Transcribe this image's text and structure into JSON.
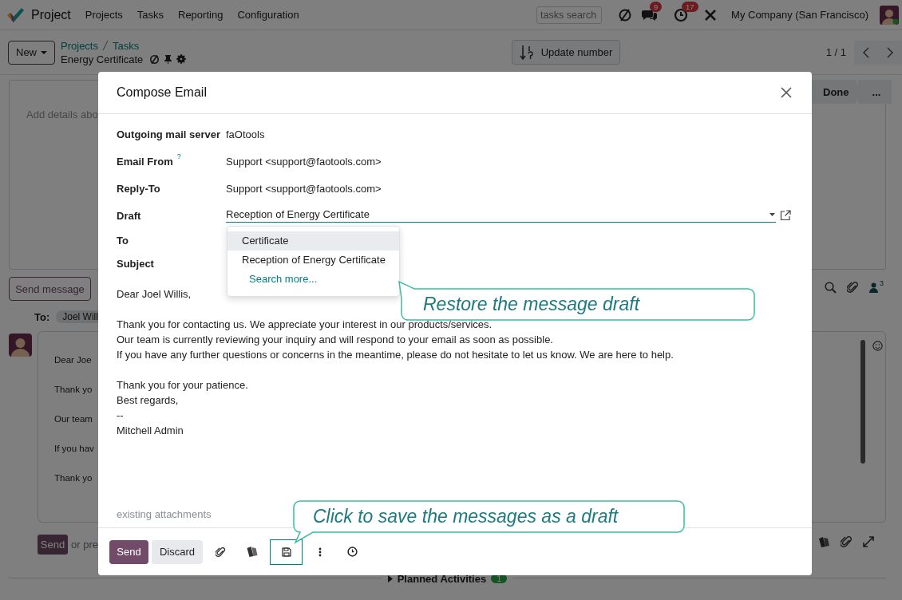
{
  "navbar": {
    "app_name": "Project",
    "menu": [
      "Projects",
      "Tasks",
      "Reporting",
      "Configuration"
    ],
    "search": {
      "placeholder": "tasks search"
    },
    "message_count": "9",
    "activity_count": "17",
    "company": "My Company (San Francisco)"
  },
  "control_panel": {
    "new_button": "New",
    "breadcrumbs": [
      "Projects",
      "Tasks"
    ],
    "record_title": "Energy Certificate",
    "action_button": "Update number",
    "pager": "1 / 1"
  },
  "form": {
    "stages": [
      "Done",
      "..."
    ],
    "description_placeholder": "Add details abo"
  },
  "chatter": {
    "send_message_button": "Send message",
    "followers_count": "3",
    "to_label": "To:",
    "recipient": "Joel Will",
    "composer_paragraphs": [
      [
        "Dear Joe"
      ],
      [
        "Thank yo",
        "Our team",
        "If you hav"
      ],
      [
        "Thank yo"
      ]
    ],
    "send_button": "Send",
    "hint": "or pre"
  },
  "planned_activities": {
    "label": "Planned Activities",
    "count": "1"
  },
  "dialog": {
    "title": "Compose Email",
    "fields": [
      {
        "kind": "text",
        "label": "Outgoing mail server",
        "value": "faOtools"
      },
      {
        "kind": "text",
        "label": "Email From",
        "help": "?",
        "value": "Support <support@faotools.com>"
      },
      {
        "kind": "text",
        "label": "Reply-To",
        "value": "Support <support@faotools.com>"
      },
      {
        "kind": "select",
        "label": "Draft",
        "value": "Reception of Energy Certificate"
      },
      {
        "kind": "blank",
        "label": "To"
      },
      {
        "kind": "blank",
        "label": "Subject"
      }
    ],
    "draft_options": [
      {
        "label": "Certificate",
        "selected": true
      },
      {
        "label": "Reception of Energy Certificate",
        "selected": false
      }
    ],
    "search_more": "Search more...",
    "body_paragraphs": [
      [
        "Dear Joel Willis,"
      ],
      [
        "Thank you for contacting us. We appreciate your interest in our products/services.",
        "Our team is currently reviewing your inquiry and will respond to your email as soon as possible.",
        "If you have any further questions or concerns in the meantime, please do not hesitate to let us know. We are here to help."
      ],
      [
        "Thank you for your patience.",
        "Best regards,",
        "--",
        "Mitchell Admin"
      ]
    ],
    "attachments_placeholder": "existing attachments",
    "send_button": "Send",
    "discard_button": "Discard"
  },
  "callouts": [
    {
      "text": "Restore the message draft"
    },
    {
      "text": "Click to save the messages as a draft"
    }
  ]
}
